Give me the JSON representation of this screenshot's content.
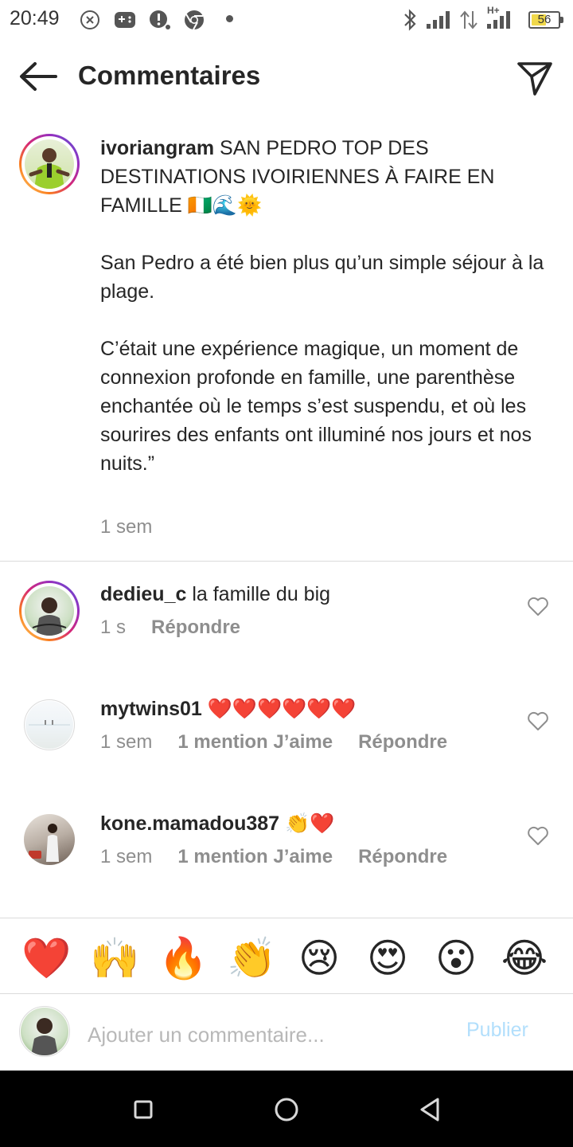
{
  "status_bar": {
    "time": "20:49",
    "network_badge": "H+",
    "battery_level": "56",
    "battery_fraction": 0.56,
    "icons": [
      "close-circle-icon",
      "gamepad-icon",
      "notification-icon",
      "chrome-icon",
      "dot-icon",
      "bluetooth-icon",
      "signal-icon",
      "data-arrows-icon",
      "signal-icon",
      "battery-icon"
    ]
  },
  "header": {
    "title": "Commentaires",
    "back_icon": "arrow-left-icon",
    "send_icon": "send-icon"
  },
  "caption": {
    "username": "ivoriangram",
    "title_text": " SAN PEDRO TOP DES DESTINATIONS IVOIRIENNES À FAIRE EN FAMILLE 🇨🇮🌊🌞",
    "paragraph_1": "San Pedro a été bien plus qu’un simple séjour à la plage.",
    "paragraph_2": "C’était une expérience magique, un moment de connexion profonde en famille, une parenthèse enchantée où le temps s’est suspendu, et où les sourires des enfants ont illuminé nos jours et nos nuits.”",
    "time": "1 sem"
  },
  "comments": [
    {
      "username": "dedieu_c",
      "text": " la famille du big",
      "time": "1 s",
      "likes": "",
      "reply": "Répondre"
    },
    {
      "username": "mytwins01",
      "text": " ❤️❤️❤️❤️❤️❤️",
      "time": "1 sem",
      "likes": "1 mention J’aime",
      "reply": "Répondre"
    },
    {
      "username": "kone.mamadou387",
      "text": " 👏❤️",
      "time": "1 sem",
      "likes": "1 mention J’aime",
      "reply": "Répondre"
    }
  ],
  "emoji_bar": [
    "❤️",
    "🙌",
    "🔥",
    "👏",
    "😢",
    "😍",
    "😮",
    "😂"
  ],
  "composer": {
    "placeholder": "Ajouter un commentaire...",
    "publish_label": "Publier"
  },
  "colors": {
    "text": "#262626",
    "muted": "#8e8e8e",
    "publish_disabled": "#b2dffc",
    "divider": "#dbdbdb"
  }
}
